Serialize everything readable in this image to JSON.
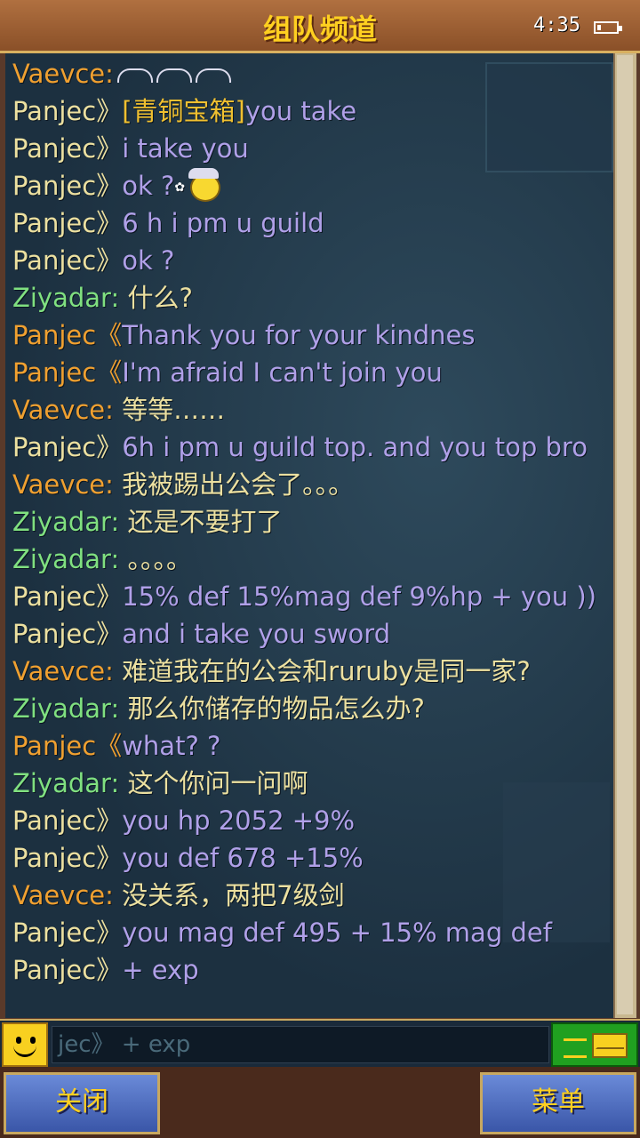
{
  "header": {
    "title": "组队频道",
    "time": "4:35"
  },
  "messages": [
    {
      "name": "Vaevce",
      "sep": ":",
      "name_color": "orange",
      "text": "",
      "text_color": "cream",
      "emote": "sweat-emotes"
    },
    {
      "name": "Panjec",
      "sep": "》",
      "name_color": "cream",
      "item": "[青铜宝箱]",
      "text": "you take",
      "text_color": "purple"
    },
    {
      "name": "Panjec",
      "sep": "》",
      "name_color": "cream",
      "text": "i take you",
      "text_color": "purple"
    },
    {
      "name": "Panjec",
      "sep": "》",
      "name_color": "cream",
      "text": "ok ?",
      "text_color": "purple",
      "emote": "viking-smiley"
    },
    {
      "name": "Panjec",
      "sep": "》",
      "name_color": "cream",
      "text": "6 h i pm u guild",
      "text_color": "purple"
    },
    {
      "name": "Panjec",
      "sep": "》",
      "name_color": "cream",
      "text": "ok ?",
      "text_color": "purple"
    },
    {
      "name": "Ziyadar",
      "sep": ":",
      "name_color": "green",
      "text": "什么?",
      "text_color": "cream"
    },
    {
      "name": "Panjec",
      "sep": "《",
      "name_color": "orange",
      "text": "Thank you for your kindnes",
      "text_color": "purple"
    },
    {
      "name": "Panjec",
      "sep": "《",
      "name_color": "orange",
      "text": "I'm afraid I can't join you",
      "text_color": "purple"
    },
    {
      "name": "Vaevce",
      "sep": ":",
      "name_color": "orange",
      "text": "等等……",
      "text_color": "cream"
    },
    {
      "name": "Panjec",
      "sep": "》",
      "name_color": "cream",
      "text": "6h i pm u guild top. and you top bro",
      "text_color": "purple"
    },
    {
      "name": "Vaevce",
      "sep": ":",
      "name_color": "orange",
      "text": "我被踢出公会了。。。",
      "text_color": "cream"
    },
    {
      "name": "Ziyadar",
      "sep": ":",
      "name_color": "green",
      "text": "还是不要打了",
      "text_color": "cream"
    },
    {
      "name": "Ziyadar",
      "sep": ":",
      "name_color": "green",
      "text": "。。。。",
      "text_color": "cream"
    },
    {
      "name": "Panjec",
      "sep": "》",
      "name_color": "cream",
      "text": "15% def 15%mag def 9%hp + you ))",
      "text_color": "purple"
    },
    {
      "name": "Panjec",
      "sep": "》",
      "name_color": "cream",
      "text": "and i take you sword",
      "text_color": "purple"
    },
    {
      "name": "Vaevce",
      "sep": ":",
      "name_color": "orange",
      "text": "难道我在的公会和ruruby是同一家?",
      "text_color": "cream"
    },
    {
      "name": "Ziyadar",
      "sep": ":",
      "name_color": "green",
      "text": "那么你储存的物品怎么办?",
      "text_color": "cream"
    },
    {
      "name": "Panjec",
      "sep": "《",
      "name_color": "orange",
      "text": "what? ?",
      "text_color": "purple"
    },
    {
      "name": "Ziyadar",
      "sep": ":",
      "name_color": "green",
      "text": "这个你问一问啊",
      "text_color": "cream"
    },
    {
      "name": "Panjec",
      "sep": "》",
      "name_color": "cream",
      "text": "you hp 2052 +9%",
      "text_color": "purple"
    },
    {
      "name": "Panjec",
      "sep": "》",
      "name_color": "cream",
      "text": "you def 678 +15%",
      "text_color": "purple"
    },
    {
      "name": "Vaevce",
      "sep": ":",
      "name_color": "orange",
      "text": "没关系，两把7级剑",
      "text_color": "cream"
    },
    {
      "name": "Panjec",
      "sep": "》",
      "name_color": "cream",
      "text": "you mag def 495 + 15% mag def",
      "text_color": "purple"
    },
    {
      "name": "Panjec",
      "sep": "》",
      "name_color": "cream",
      "text": "+ exp",
      "text_color": "purple"
    }
  ],
  "input": {
    "value": "jec》 + exp"
  },
  "buttons": {
    "close": "关闭",
    "menu": "菜单"
  },
  "colors": {
    "orange": "#f0a030",
    "green": "#80e080",
    "cream": "#ece0a0",
    "purple": "#b0a0e8",
    "item": "#f0c030",
    "header_title": "#ffd020"
  },
  "icons": {
    "smiley_button": "smiley-icon",
    "send_button": "envelope-icon",
    "battery": "battery-icon"
  }
}
